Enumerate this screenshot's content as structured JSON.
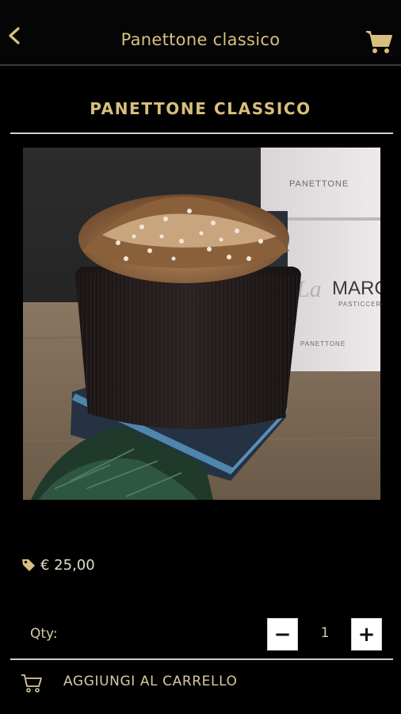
{
  "app_bar": {
    "title": "Panettone classico"
  },
  "product": {
    "name": "PANETTONE CLASSICO",
    "price": "€ 25,00",
    "box_text_top": "PANETTONE",
    "box_brand_script": "La",
    "box_brand_name": "MARCA",
    "box_brand_sub": "PASTICCERIA",
    "box_text_bottom": "PANETTONE"
  },
  "quantity": {
    "label": "Qty:",
    "value": "1",
    "minus": "−",
    "plus": "+"
  },
  "actions": {
    "add_to_cart_label": "AGGIUNGI AL CARRELLO"
  },
  "colors": {
    "accent_gold": "#d9bf7e",
    "background": "#000000",
    "divider": "#cfcfcf"
  }
}
